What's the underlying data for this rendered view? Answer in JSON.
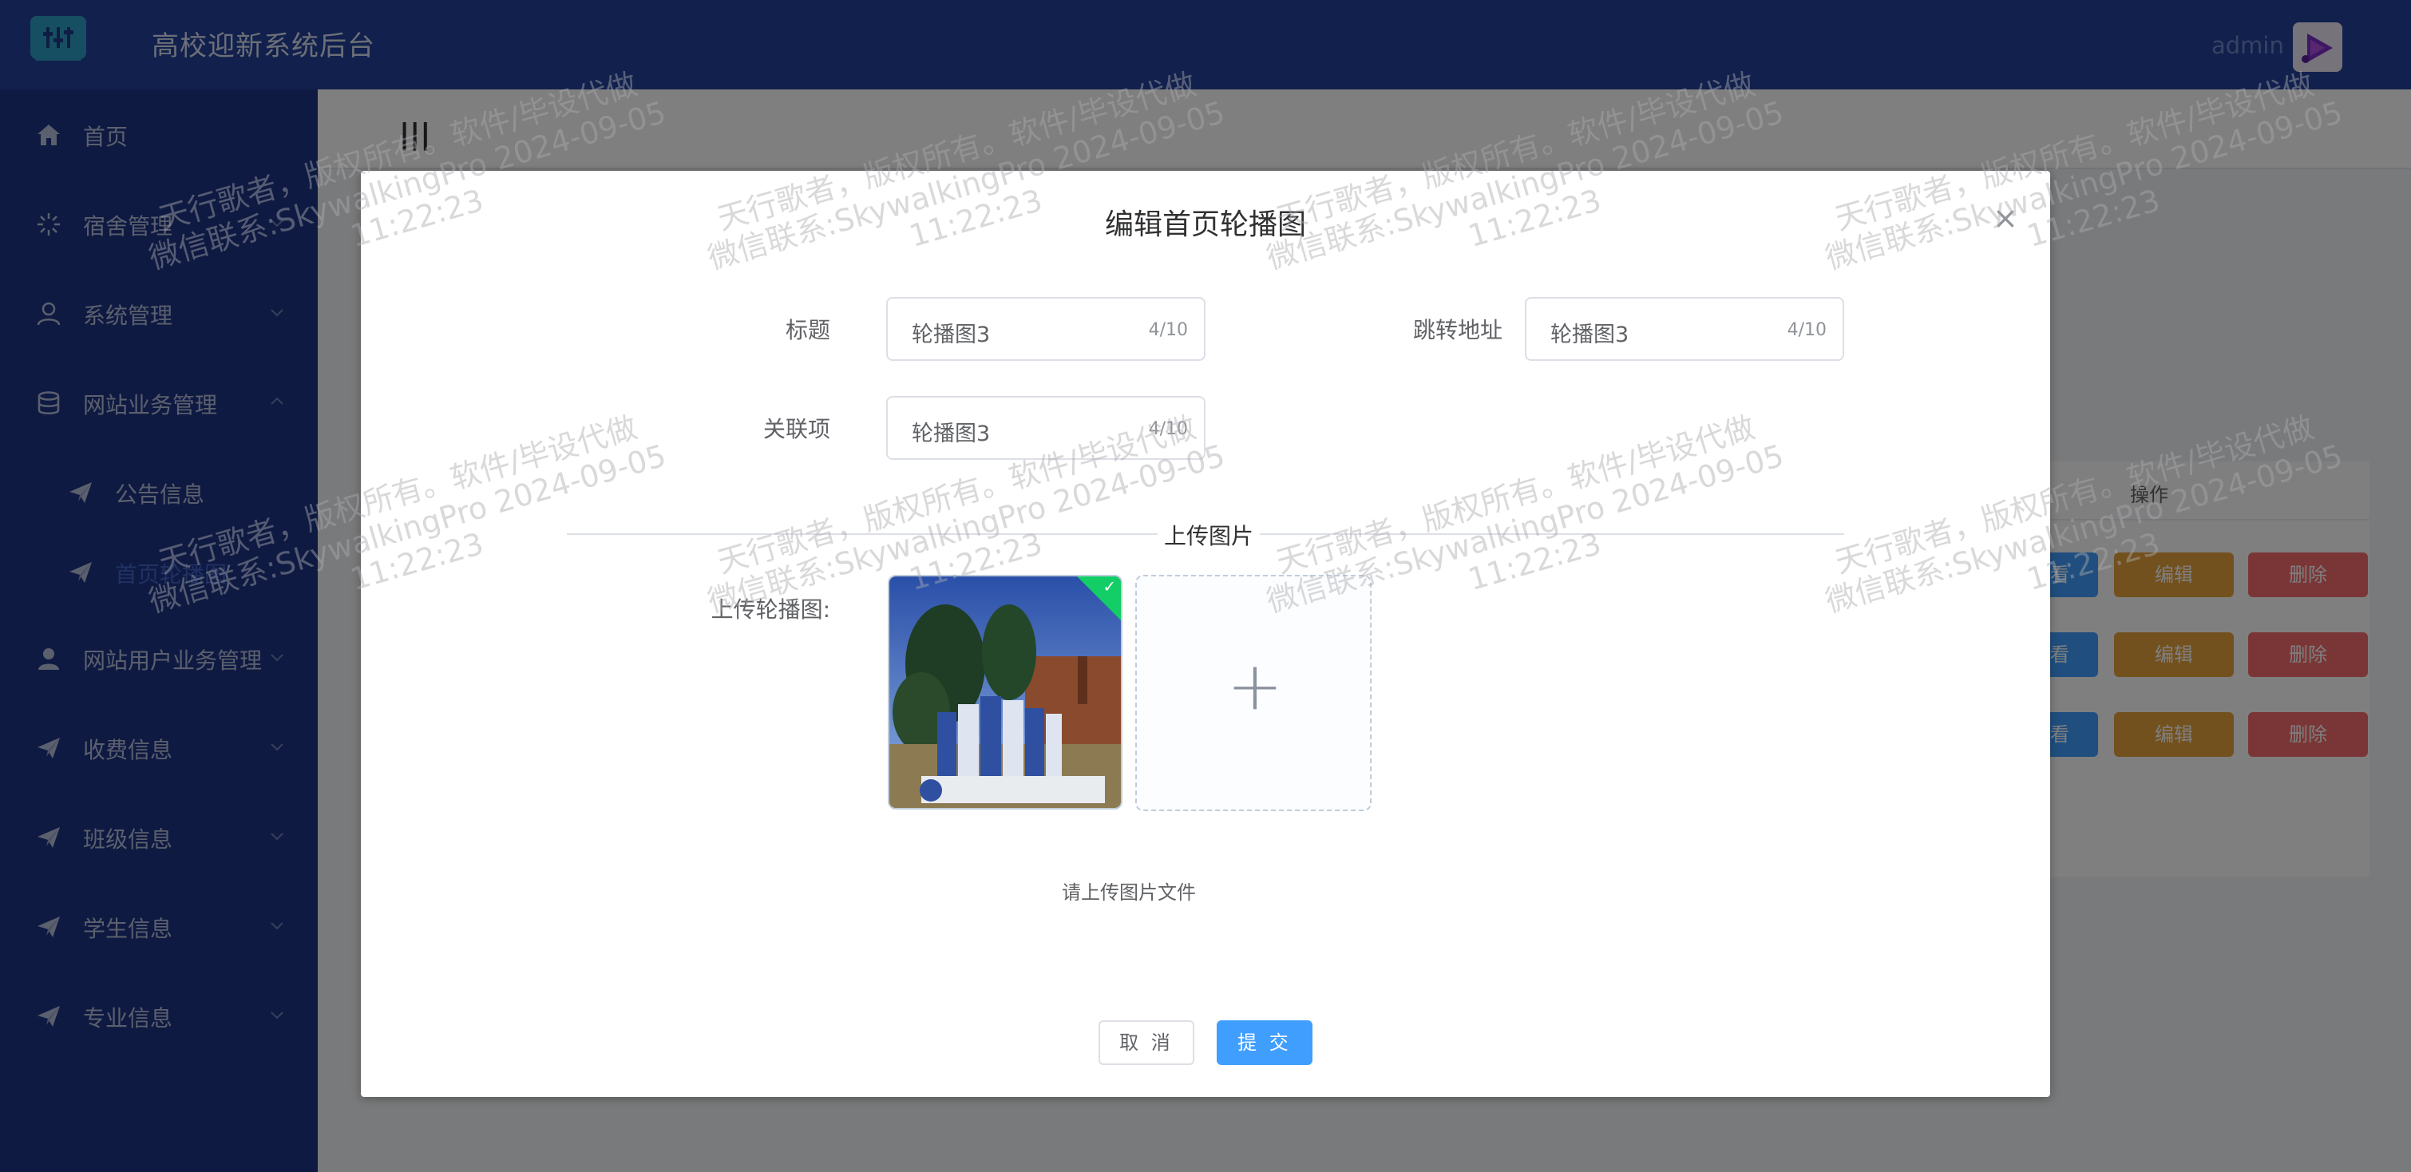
{
  "header": {
    "app_title": "高校迎新系统后台",
    "admin_name": "admin"
  },
  "sidebar": {
    "items": [
      {
        "label": "首页",
        "icon": "home-icon"
      },
      {
        "label": "宿舍管理",
        "icon": "sun-icon"
      },
      {
        "label": "系统管理",
        "icon": "user-outline-icon"
      },
      {
        "label": "网站业务管理",
        "icon": "database-icon"
      },
      {
        "label": "公告信息",
        "icon": "send-icon"
      },
      {
        "label": "首页轮播图",
        "icon": "send-icon"
      },
      {
        "label": "网站用户业务管理",
        "icon": "user-filled-icon"
      },
      {
        "label": "收费信息",
        "icon": "send-icon"
      },
      {
        "label": "班级信息",
        "icon": "send-icon"
      },
      {
        "label": "学生信息",
        "icon": "send-icon"
      },
      {
        "label": "专业信息",
        "icon": "send-icon"
      }
    ]
  },
  "main": {
    "collapse_icon": "|||",
    "table_header": "操作",
    "row_buttons": {
      "view": "查看",
      "edit": "编辑",
      "delete": "删除"
    }
  },
  "dialog": {
    "title": "编辑首页轮播图",
    "close": "×",
    "fields": {
      "title_label": "标题",
      "title_value": "轮播图3",
      "title_count": "4/10",
      "url_label": "跳转地址",
      "url_value": "轮播图3",
      "url_count": "4/10",
      "related_label": "关联项",
      "related_value": "轮播图3",
      "related_count": "4/10"
    },
    "upload_section": "上传图片",
    "upload_label": "上传轮播图:",
    "upload_add": "+",
    "upload_tip": "请上传图片文件",
    "cancel_label": "取 消",
    "submit_label": "提 交"
  },
  "watermark": {
    "line1": "天行歌者，版权所有。软件/毕设代做",
    "line2": "微信联系:SkywalkingPro 2024-09-05",
    "line3": "11:22:23"
  },
  "colors": {
    "header_bg": "#22409a",
    "sidebar_bg": "#1e3585",
    "primary": "#409eff",
    "warning": "#e6a23c",
    "danger": "#f56c6c",
    "success": "#13ce66"
  }
}
